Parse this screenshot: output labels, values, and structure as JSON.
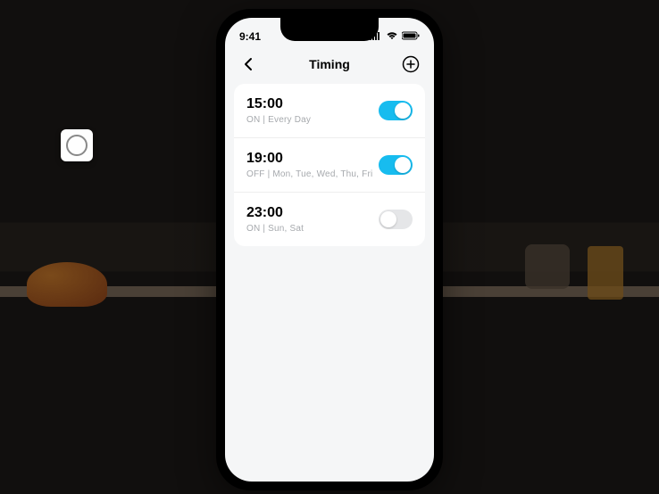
{
  "status": {
    "time": "9:41"
  },
  "nav": {
    "title": "Timing"
  },
  "schedule": [
    {
      "time": "15:00",
      "subtitle": "ON  |  Every Day",
      "enabled": true
    },
    {
      "time": "19:00",
      "subtitle": "OFF  |  Mon, Tue, Wed, Thu, Fri",
      "enabled": true
    },
    {
      "time": "23:00",
      "subtitle": "ON  |  Sun, Sat",
      "enabled": false
    }
  ],
  "colors": {
    "accent": "#17bcef"
  }
}
